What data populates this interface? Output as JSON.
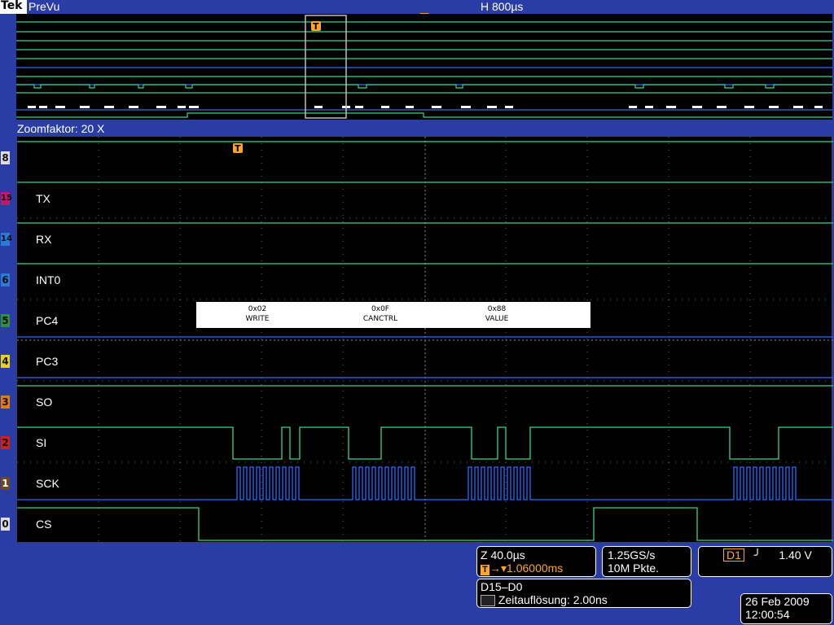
{
  "header": {
    "brand": "Tek",
    "mode": "PreVu",
    "horizontal_scale": "H 800µs"
  },
  "zoom": {
    "label": "Zoomfaktor: 20 X"
  },
  "channels": [
    {
      "badge": "8",
      "name": "",
      "badge_color": "#dcdcdc"
    },
    {
      "badge": "15",
      "name": "TX",
      "badge_color": "#c0196b"
    },
    {
      "badge": "14",
      "name": "RX",
      "badge_color": "#2b7ad8"
    },
    {
      "badge": "6",
      "name": "INT0",
      "badge_color": "#2b7ad8"
    },
    {
      "badge": "5",
      "name": "PC4",
      "badge_color": "#2f8f3a"
    },
    {
      "badge": "4",
      "name": "PC3",
      "badge_color": "#e6d21a"
    },
    {
      "badge": "3",
      "name": "SO",
      "badge_color": "#e07b1a"
    },
    {
      "badge": "2",
      "name": "SI",
      "badge_color": "#d0201a"
    },
    {
      "badge": "1",
      "name": "SCK",
      "badge_color": "#6b4a22"
    },
    {
      "badge": "0",
      "name": "CS",
      "badge_color": "#dcdcdc"
    }
  ],
  "decode": {
    "fields": [
      {
        "value": "0x02",
        "label": "WRITE"
      },
      {
        "value": "0x0F",
        "label": "CANCTRL"
      },
      {
        "value": "0x88",
        "label": "VALUE"
      }
    ]
  },
  "readouts": {
    "zoom_scale": "Z 40.0µs",
    "trigger_position": "1.06000ms",
    "sample_rate": "1.25GS/s",
    "record_length": "10M Pkte.",
    "trigger_source": "D1",
    "trigger_slope_symbol": "╯",
    "trigger_level": "1.40 V",
    "bus_name": "D15–D0",
    "timing_resolution": "Zeitauflösung: 2.00ns",
    "date": "26 Feb  2009",
    "time": "12:00:54"
  },
  "colors": {
    "background": "#2a3da6",
    "trace_green": "#38d48a",
    "trace_blue": "#2a6cff",
    "grid": "#6a6a6a",
    "trigger_orange": "#ffa62a"
  }
}
